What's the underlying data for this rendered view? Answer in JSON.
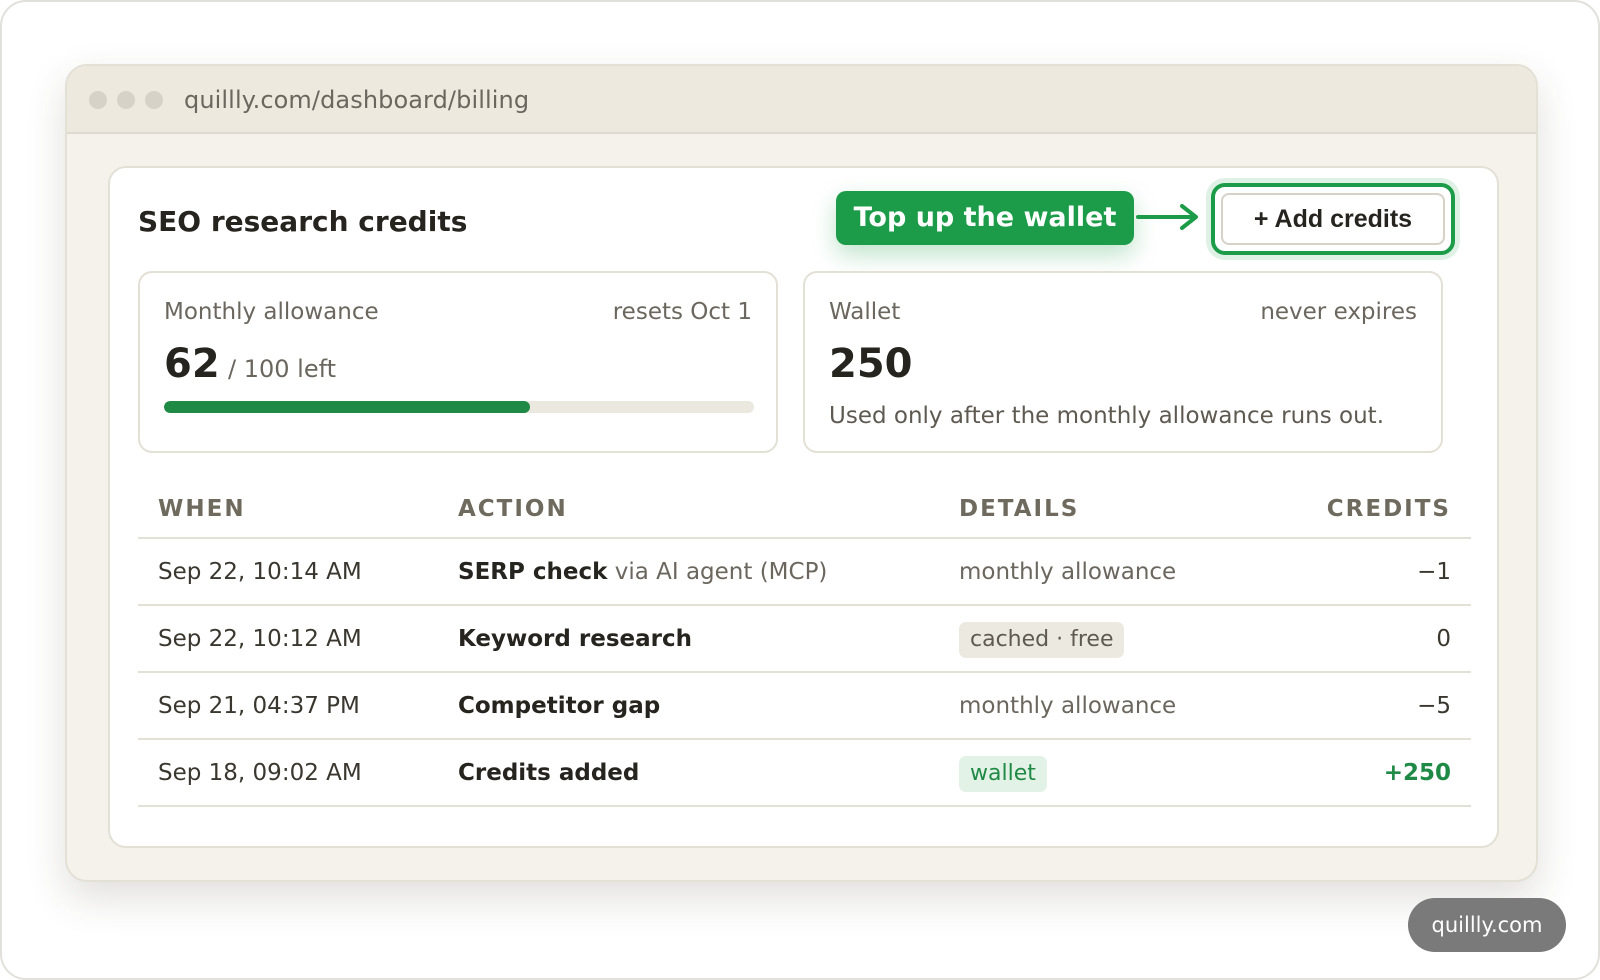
{
  "browser": {
    "url": "quillly.com/dashboard/billing"
  },
  "page": {
    "title": "SEO research credits",
    "callout": "Top up the wallet",
    "add_credits_label": "+ Add credits"
  },
  "allowance": {
    "label": "Monthly allowance",
    "note": "resets Oct 1",
    "remaining": "62",
    "of_total": "/ 100 left",
    "fraction_remaining": 0.62
  },
  "wallet": {
    "label": "Wallet",
    "note": "never expires",
    "value": "250",
    "description": "Used only after the monthly allowance runs out."
  },
  "table": {
    "headers": [
      "WHEN",
      "ACTION",
      "DETAILS",
      "CREDITS"
    ],
    "rows": [
      {
        "when": "Sep 22, 10:14 AM",
        "action": "SERP check",
        "action_extra": "via AI agent (MCP)",
        "details": "monthly allowance",
        "credits": "−1"
      },
      {
        "when": "Sep 22, 10:12 AM",
        "action": "Keyword research",
        "action_extra": "",
        "details": "cached · free",
        "credits": "0"
      },
      {
        "when": "Sep 21, 04:37 PM",
        "action": "Competitor gap",
        "action_extra": "",
        "details": "monthly allowance",
        "credits": "−5"
      },
      {
        "when": "Sep 18, 09:02 AM",
        "action": "Credits added",
        "action_extra": "",
        "details": "wallet",
        "credits": "+250"
      }
    ]
  },
  "watermark": "quillly.com",
  "colors": {
    "accent_green": "#1c9c49",
    "progress_green": "#1f8a45",
    "background": "#f4f2ea"
  }
}
